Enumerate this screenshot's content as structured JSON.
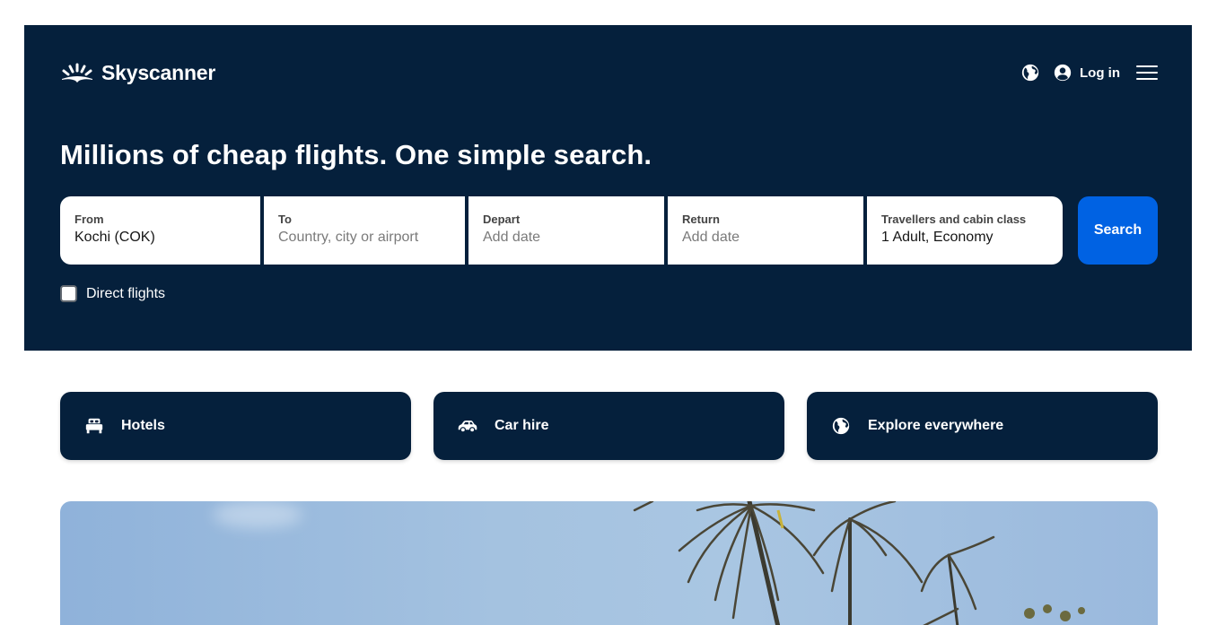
{
  "header": {
    "brand": "Skyscanner",
    "nav": {
      "region_icon": "globe-icon",
      "account_icon": "user-circle-icon",
      "login_label": "Log in",
      "menu_icon": "hamburger-menu-icon"
    },
    "headline": "Millions of cheap flights. One simple search."
  },
  "search": {
    "fields": [
      {
        "label": "From",
        "value": "Kochi (COK)",
        "placeholder": ""
      },
      {
        "label": "To",
        "value": "",
        "placeholder": "Country, city or airport"
      },
      {
        "label": "Depart",
        "value": "",
        "placeholder": "Add date"
      },
      {
        "label": "Return",
        "value": "",
        "placeholder": "Add date"
      },
      {
        "label": "Travellers and cabin class",
        "value": "1 Adult, Economy",
        "placeholder": ""
      }
    ],
    "search_label": "Search",
    "direct_flights_label": "Direct flights",
    "direct_flights_checked": false
  },
  "quick_links": [
    {
      "label": "Hotels",
      "icon": "bed-icon"
    },
    {
      "label": "Car hire",
      "icon": "car-icon"
    },
    {
      "label": "Explore everywhere",
      "icon": "globe-icon"
    }
  ],
  "colors": {
    "brand_navy": "#05203c",
    "search_blue": "#0062e3"
  }
}
